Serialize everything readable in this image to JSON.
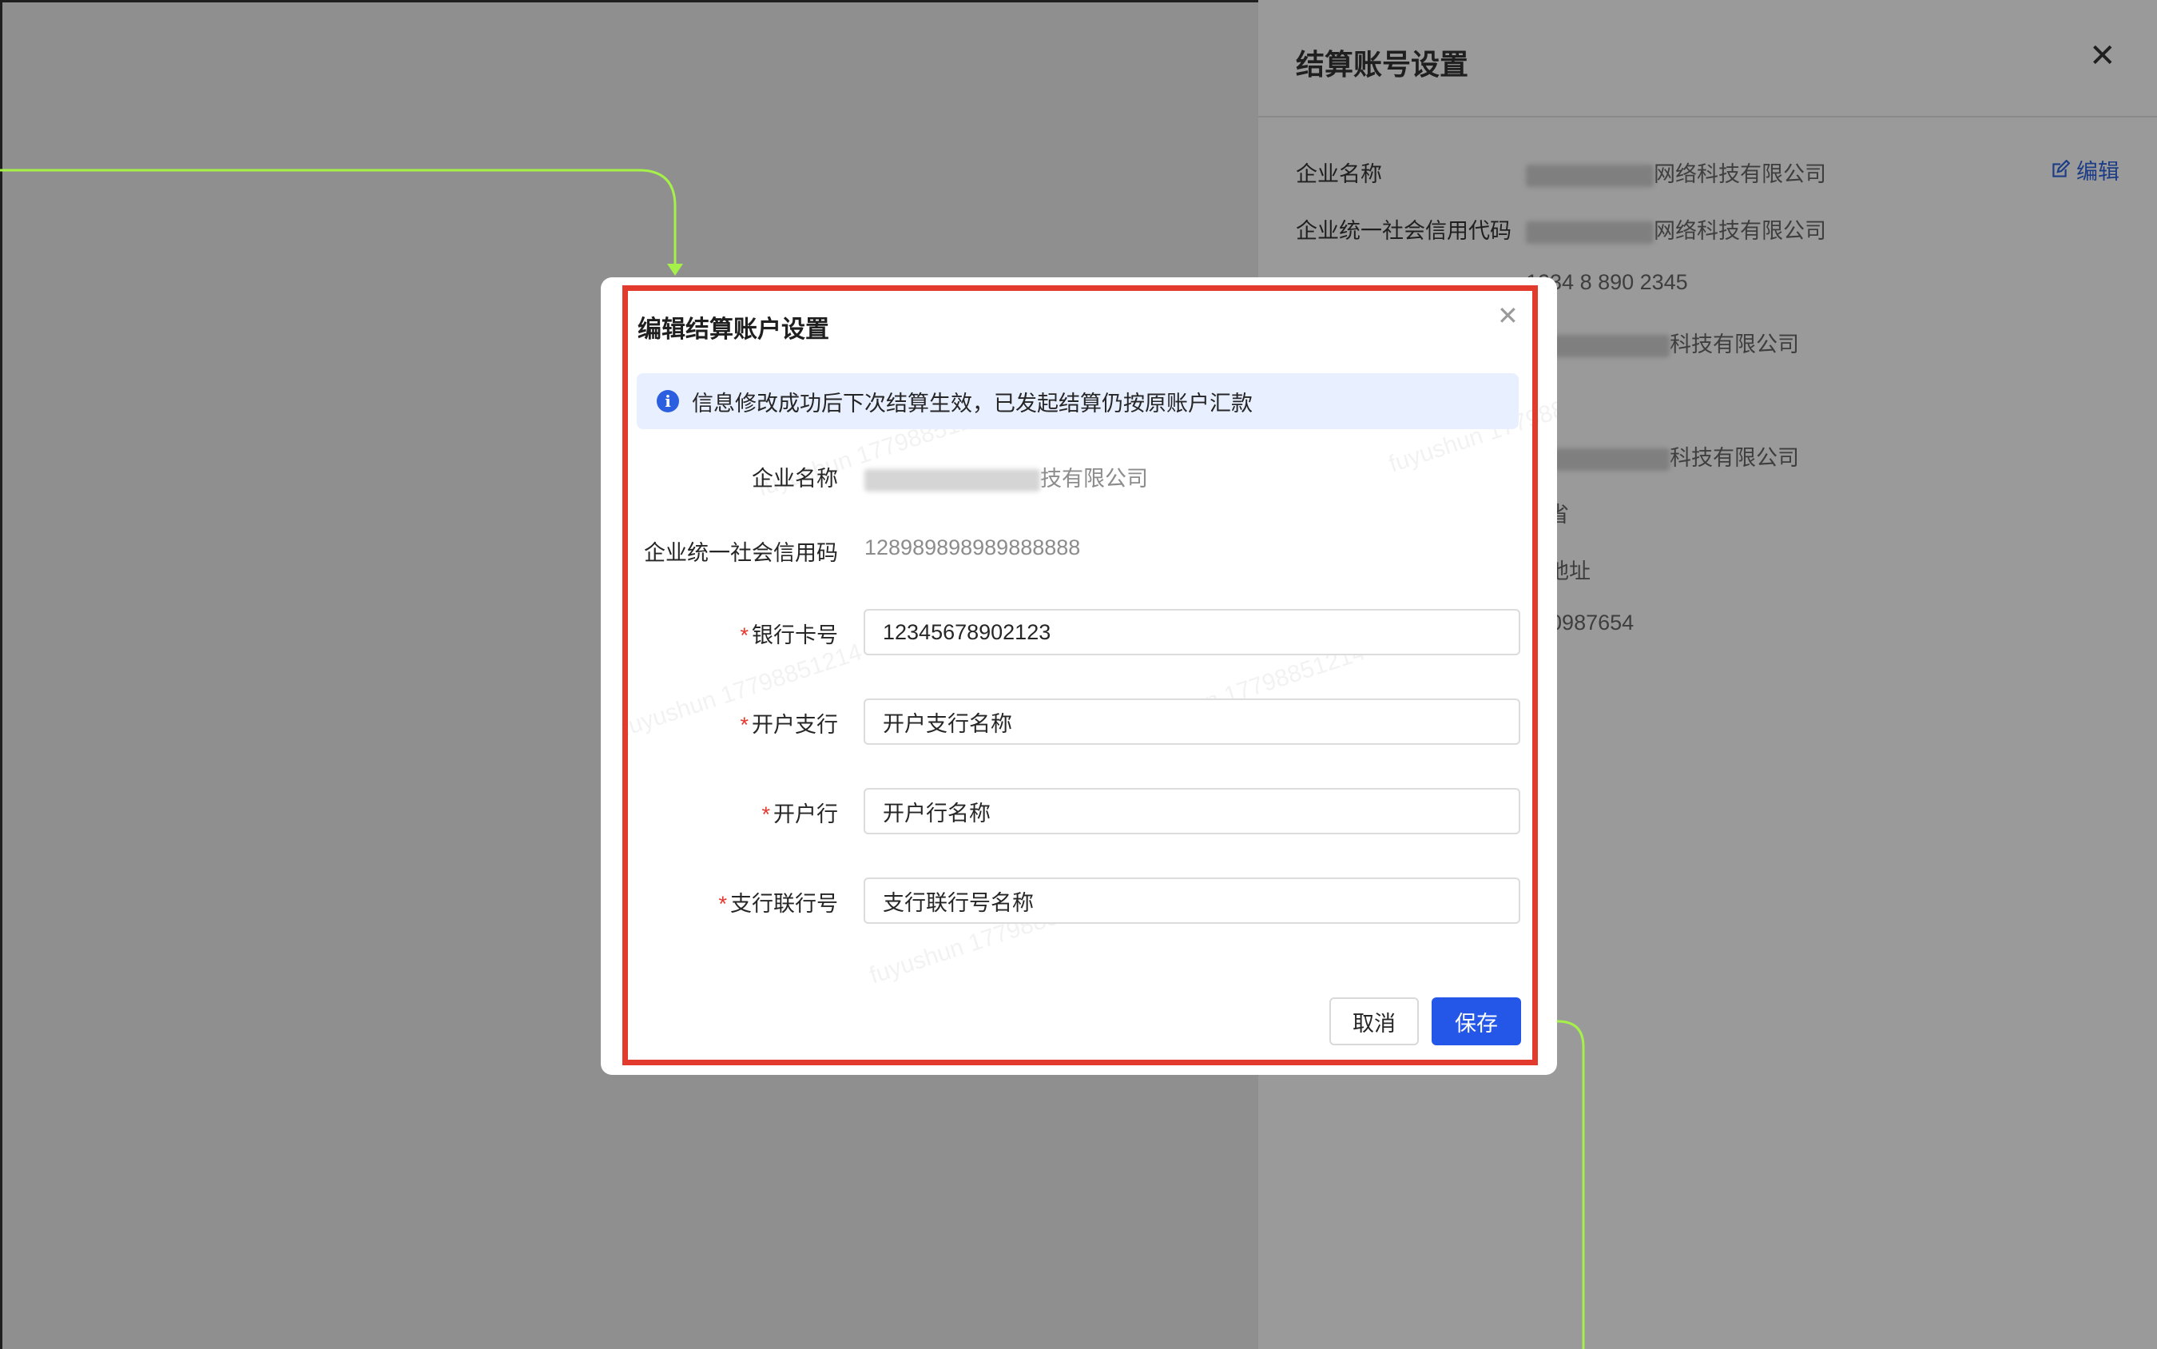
{
  "drawer": {
    "title": "结算账号设置",
    "close": "✕",
    "edit_label": "编辑",
    "rows": [
      {
        "label": "企业名称",
        "value": "网络科技有限公司"
      },
      {
        "label": "企业统一社会信用代码",
        "value": "网络科技有限公司"
      },
      {
        "label": "",
        "value": "1234 8   890 2345"
      },
      {
        "label": "",
        "value": "科技有限公司"
      },
      {
        "label": "",
        "value": "科技有限公司"
      },
      {
        "label": "",
        "value": "北省"
      },
      {
        "label": "",
        "value": "细地址"
      },
      {
        "label": "",
        "value": "520987654"
      }
    ]
  },
  "modal": {
    "title": "编辑结算账户设置",
    "close": "✕",
    "alert": "信息修改成功后下次结算生效，已发起结算仍按原账户汇款",
    "info_icon": "i",
    "fields": {
      "company_name": {
        "label": "企业名称",
        "value": "技有限公司"
      },
      "credit_code": {
        "label": "企业统一社会信用码",
        "value": "128989898989888888"
      },
      "bank_card": {
        "label": "银行卡号",
        "value": "12345678902123",
        "required": "*"
      },
      "branch": {
        "label": "开户支行",
        "value": "开户支行名称",
        "required": "*"
      },
      "bank": {
        "label": "开户行",
        "value": "开户行名称",
        "required": "*"
      },
      "branch_code": {
        "label": "支行联行号",
        "value": "支行联行号名称",
        "required": "*"
      }
    },
    "cancel_label": "取消",
    "save_label": "保存",
    "watermark": "fuyushun 17798851214"
  },
  "colors": {
    "primary": "#2457e8",
    "highlight_box": "#e23b2e",
    "annotation_line": "#a6f04a",
    "required": "#e5382d"
  }
}
